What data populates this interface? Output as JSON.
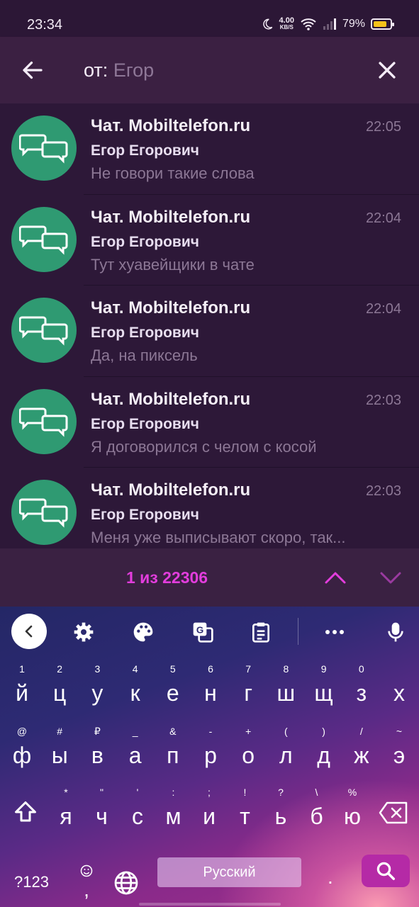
{
  "status": {
    "time": "23:34",
    "speed_value": "4.00",
    "speed_unit": "KB/S",
    "battery": "79%"
  },
  "search": {
    "prefix": "от:",
    "value": "Егор",
    "back_icon": "arrow-left-icon",
    "clear_icon": "close-icon"
  },
  "messages": [
    {
      "chat": "Чат. Mobiltelefon.ru",
      "time": "22:05",
      "sender": "Егор Егорович",
      "text": "Не говори такие слова"
    },
    {
      "chat": "Чат. Mobiltelefon.ru",
      "time": "22:04",
      "sender": "Егор Егорович",
      "text": "Тут хуавейщики в чате"
    },
    {
      "chat": "Чат. Mobiltelefon.ru",
      "time": "22:04",
      "sender": "Егор Егорович",
      "text": "Да, на пиксель"
    },
    {
      "chat": "Чат. Mobiltelefon.ru",
      "time": "22:03",
      "sender": "Егор Егорович",
      "text": "Я договорился с челом с косой"
    },
    {
      "chat": "Чат. Mobiltelefon.ru",
      "time": "22:03",
      "sender": "Егор Егорович",
      "text": "Меня уже выписывают скоро, так..."
    }
  ],
  "results": {
    "counter": "1 из 22306"
  },
  "colors": {
    "accent": "#e33ddd",
    "avatar": "#2f9a72",
    "panel": "#3b2042",
    "list_bg": "#2d1838"
  },
  "keyboard": {
    "row1": [
      [
        "й",
        "1"
      ],
      [
        "ц",
        "2"
      ],
      [
        "у",
        "3"
      ],
      [
        "к",
        "4"
      ],
      [
        "е",
        "5"
      ],
      [
        "н",
        "6"
      ],
      [
        "г",
        "7"
      ],
      [
        "ш",
        "8"
      ],
      [
        "щ",
        "9"
      ],
      [
        "з",
        "0"
      ],
      [
        "х",
        ""
      ]
    ],
    "row2": [
      [
        "ф",
        "@"
      ],
      [
        "ы",
        "#"
      ],
      [
        "в",
        "₽"
      ],
      [
        "а",
        "_"
      ],
      [
        "п",
        "&"
      ],
      [
        "р",
        "-"
      ],
      [
        "о",
        "+"
      ],
      [
        "л",
        "("
      ],
      [
        "д",
        ")"
      ],
      [
        "ж",
        "/"
      ],
      [
        "э",
        "~"
      ]
    ],
    "row3": [
      [
        "я",
        "*"
      ],
      [
        "ч",
        "\""
      ],
      [
        "с",
        "'"
      ],
      [
        "м",
        ":"
      ],
      [
        "и",
        ";"
      ],
      [
        "т",
        "!"
      ],
      [
        "ь",
        "?"
      ],
      [
        "б",
        "\\"
      ],
      [
        "ю",
        "%"
      ]
    ],
    "symbols_label": "?123",
    "comma": ",",
    "space_label": "Русский",
    "dot": "."
  }
}
